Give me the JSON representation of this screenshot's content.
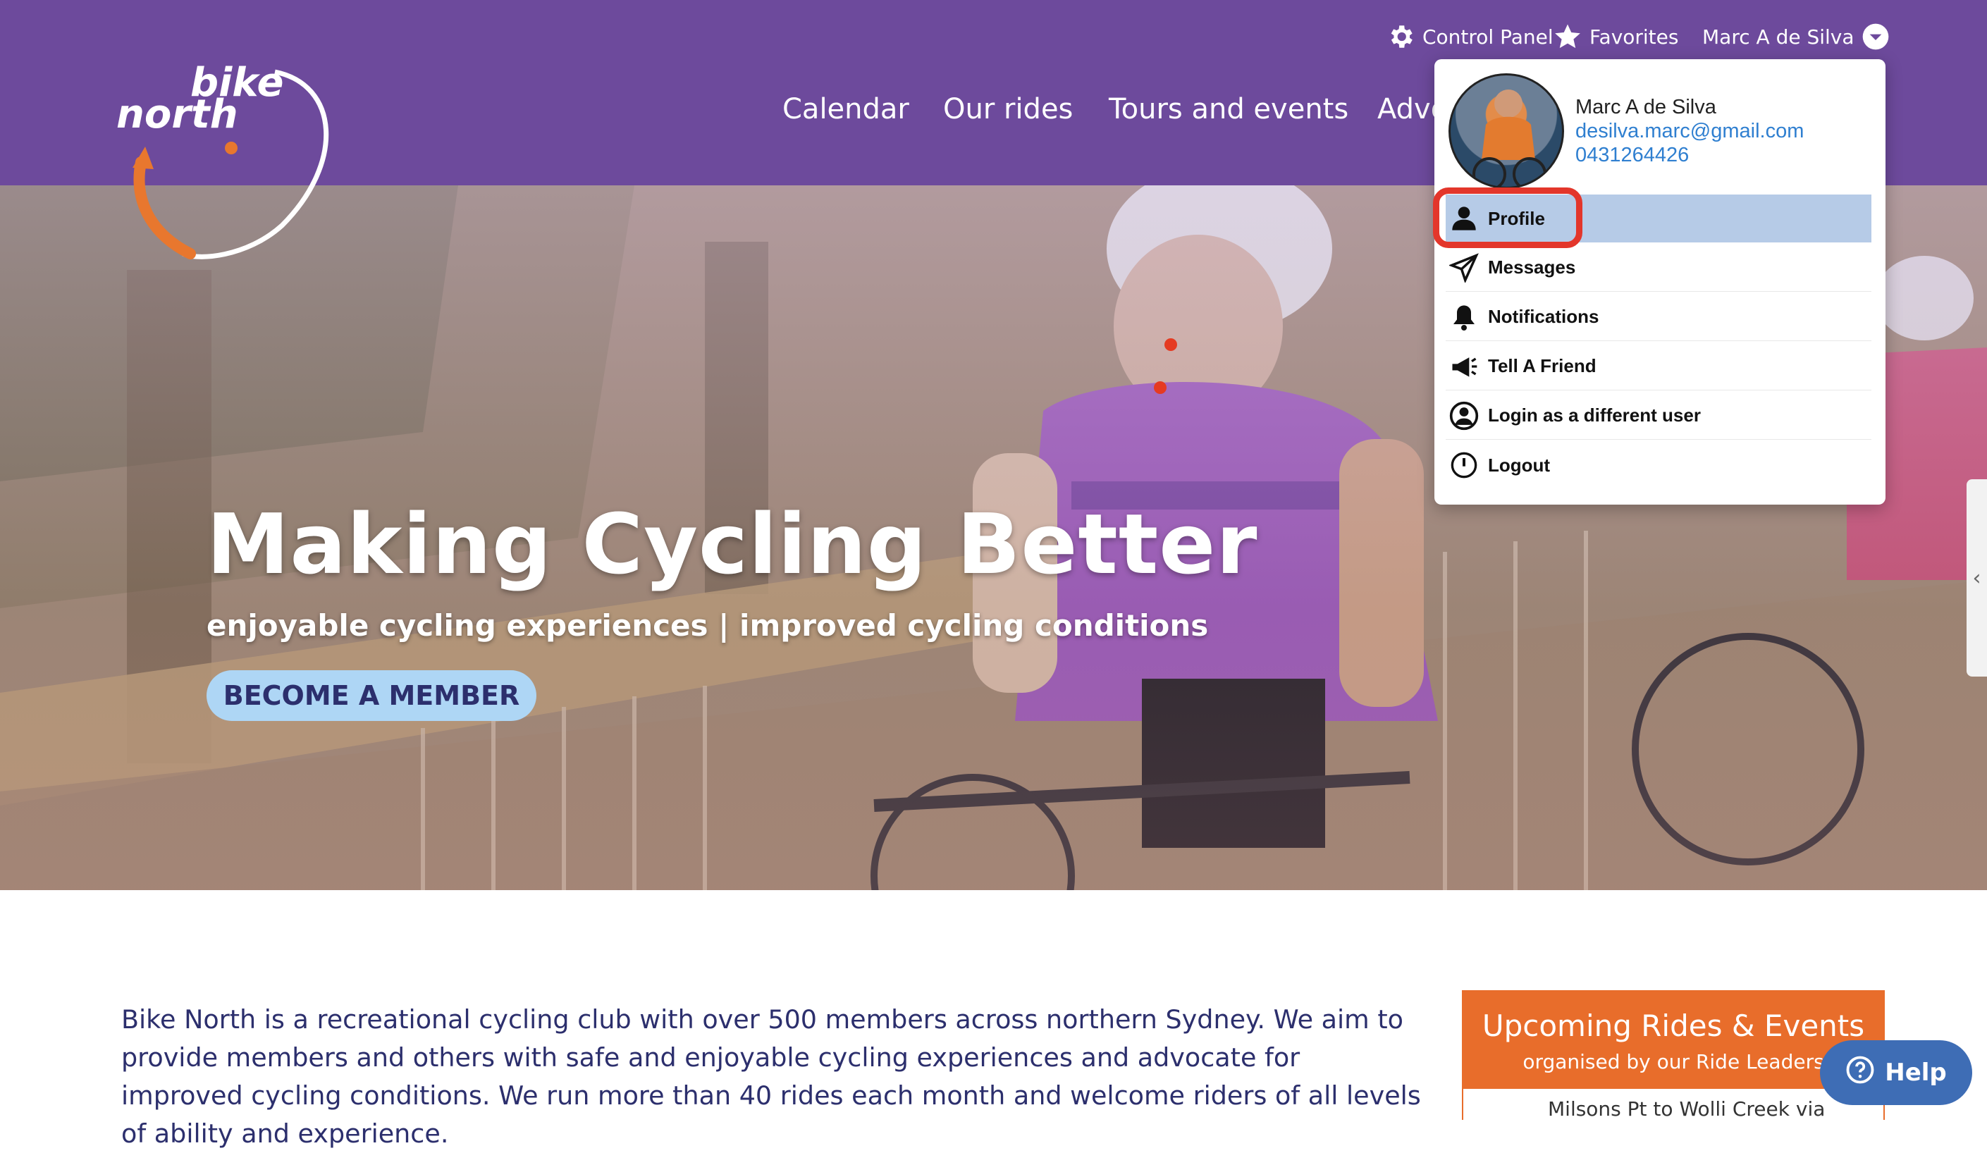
{
  "header": {
    "control_panel": "Control Panel",
    "favorites": "Favorites",
    "user_name": "Marc A de Silva",
    "logo_line1": "bike",
    "logo_line2": "north",
    "nav": [
      "Calendar",
      "Our rides",
      "Tours and events",
      "Advo"
    ]
  },
  "hero": {
    "title": "Making Cycling Better",
    "subtitle": "enjoyable cycling experiences | improved cycling conditions",
    "cta": "BECOME A MEMBER"
  },
  "intro_text": "Bike North is a recreational cycling club with over 500 members across northern Sydney. We aim to provide members and others with safe and enjoyable cycling experiences and advocate for improved cycling conditions. We run more than 40 rides each month and welcome riders of all levels of ability and experience.",
  "events": {
    "title": "Upcoming Rides & Events",
    "subtitle": "organised by our Ride Leaders",
    "first_item": "Milsons Pt to Wolli Creek via"
  },
  "help_label": "Help",
  "user_menu": {
    "name": "Marc A de Silva",
    "email": "desilva.marc@gmail.com",
    "phone": "0431264426",
    "items": [
      {
        "label": "Profile",
        "icon": "person-icon"
      },
      {
        "label": "Messages",
        "icon": "paper-plane-icon"
      },
      {
        "label": "Notifications",
        "icon": "bell-icon"
      },
      {
        "label": "Tell A Friend",
        "icon": "megaphone-icon"
      },
      {
        "label": "Login as a different user",
        "icon": "user-switch-icon"
      },
      {
        "label": "Logout",
        "icon": "power-icon"
      }
    ]
  },
  "colors": {
    "header_purple": "#6d4a9c",
    "highlight_red": "#e3362b",
    "active_item": "#b6cbe7",
    "events_orange": "#e86d2b",
    "help_blue": "#3e6db5"
  }
}
